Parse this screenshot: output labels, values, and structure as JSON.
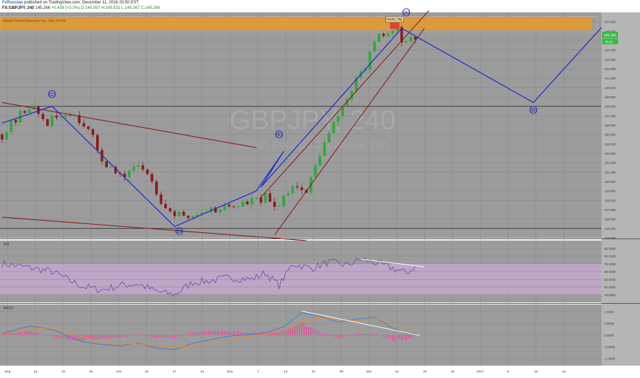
{
  "header": {
    "publisher": "FxRussian",
    "published_text": "published on TradingView.com, December 11, 2016 20:50 EST",
    "symbol": "FX:GBPJPY, 240",
    "last": "145.266",
    "change": "+0.439 (+0.3%)",
    "ohlc": "O:145.097 H:145.531 L:145.087 C:145.266"
  },
  "watermark": {
    "main": "GBPJPY, 240",
    "sub": "British Pound / Japanese Yen"
  },
  "indicator_labels": {
    "series_name": "British Pound/Japanese Yen, 240, FXCM",
    "rsi": "RSI",
    "macd": "MACD"
  },
  "price_tags": {
    "current": "145.266",
    "countdown": "05:02"
  },
  "annotations": {
    "fractal": "FRACTAL",
    "wave_c": "(C)",
    "wave_d": "(D)",
    "wave_e": "(E)",
    "wave_a": "(A)",
    "wave_b": "(B)"
  },
  "colors": {
    "background": "#9c9c9c",
    "grid": "#8a8a8a",
    "up_candle": "#2fa83a",
    "down_candle": "#8a1c1c",
    "channel_line": "#8b1a1a",
    "wave_line": "#1e2fd1",
    "resistance_zone": "#e99a2a",
    "fractal_box": "#e0452b",
    "rsi_line": "#7a4a9e",
    "rsi_band": "#c9aad6",
    "macd_line": "#2f7fd8",
    "signal_line": "#f08a24",
    "histogram": "#e0559a",
    "divergence_line": "#ffffff"
  },
  "chart_data": [
    {
      "panel": "price",
      "type": "candlestick",
      "title": "FX:GBPJPY, 240",
      "ylabel": "",
      "ylim": [
        124.0,
        148.0
      ],
      "y_ticks": [
        "147.000",
        "146.000",
        "145.000",
        "144.000",
        "143.000",
        "142.000",
        "141.000",
        "140.000",
        "139.000",
        "138.000",
        "137.000",
        "136.000",
        "135.000",
        "134.000",
        "133.000",
        "132.000",
        "131.000",
        "130.000",
        "129.000",
        "128.000",
        "127.000",
        "126.000",
        "125.000",
        "124.000"
      ],
      "x_ticks": [
        "Sep",
        "12",
        "19",
        "26",
        "Oct",
        "10",
        "17",
        "24",
        "Nov",
        "7",
        "14",
        "21",
        "28",
        "Dec",
        "12",
        "19",
        "26",
        "2017",
        "9",
        "16",
        "23"
      ],
      "current_price": 145.266,
      "resistance_zone": [
        146.1,
        147.4
      ],
      "horizontal_levels": [
        138.0,
        125.0
      ],
      "price_path": [
        [
          0,
          135.0
        ],
        [
          6,
          138.1
        ],
        [
          10,
          136.2
        ],
        [
          15,
          137.5
        ],
        [
          18,
          136.3
        ],
        [
          22,
          132.5
        ],
        [
          26,
          130.3
        ],
        [
          29,
          131.6
        ],
        [
          32,
          131.0
        ],
        [
          36,
          127.2
        ],
        [
          40,
          126.0
        ],
        [
          44,
          126.9
        ],
        [
          52,
          127.5
        ],
        [
          58,
          128.2
        ],
        [
          60,
          127.1
        ],
        [
          64,
          129.8
        ],
        [
          67,
          128.8
        ],
        [
          70,
          133.0
        ],
        [
          75,
          138.0
        ],
        [
          79,
          141.5
        ],
        [
          83,
          145.3
        ],
        [
          87,
          146.1
        ],
        [
          89,
          144.4
        ],
        [
          91,
          145.3
        ]
      ],
      "wave_points": {
        "start": [
          0,
          137.0
        ],
        "C": [
          11,
          138.0
        ],
        "D": [
          38,
          125.2
        ],
        "E": [
          62,
          134.2
        ],
        "B": [
          117,
          138.1
        ]
      },
      "wave_path": [
        [
          0,
          136.2
        ],
        [
          11,
          138.0
        ],
        [
          38,
          125.2
        ],
        [
          56,
          129.0
        ],
        [
          62,
          133.2
        ],
        [
          57,
          129.4
        ],
        [
          88,
          146.3
        ],
        [
          117,
          138.4
        ],
        [
          132,
          146.4
        ]
      ],
      "channels": [
        {
          "from": [
            0,
            138.4
          ],
          "to": [
            56,
            133.6
          ]
        },
        {
          "from": [
            0,
            126.2
          ],
          "to": [
            67,
            123.7
          ]
        },
        {
          "from": [
            57,
            128.3
          ],
          "to": [
            94,
            148.2
          ]
        },
        {
          "from": [
            60,
            124.3
          ],
          "to": [
            93,
            146.3
          ]
        }
      ]
    },
    {
      "panel": "rsi",
      "type": "line",
      "title": "RSI",
      "ylim": [
        20,
        100
      ],
      "y_ticks": [
        "90.0000",
        "80.0000",
        "70.0000",
        "60.0000",
        "50.0000",
        "40.0000",
        "30.0000"
      ],
      "band": [
        30,
        70
      ],
      "divergence": {
        "from": [
          79,
          76
        ],
        "to": [
          93,
          66
        ]
      },
      "values": [
        [
          0,
          70
        ],
        [
          5,
          66
        ],
        [
          11,
          60
        ],
        [
          15,
          48
        ],
        [
          18,
          40
        ],
        [
          22,
          36
        ],
        [
          26,
          42
        ],
        [
          30,
          44
        ],
        [
          34,
          34
        ],
        [
          38,
          30
        ],
        [
          42,
          46
        ],
        [
          46,
          48
        ],
        [
          50,
          52
        ],
        [
          55,
          50
        ],
        [
          58,
          58
        ],
        [
          61,
          42
        ],
        [
          64,
          70
        ],
        [
          68,
          64
        ],
        [
          72,
          72
        ],
        [
          76,
          68
        ],
        [
          79,
          76
        ],
        [
          83,
          70
        ],
        [
          86,
          64
        ],
        [
          89,
          58
        ],
        [
          91,
          66
        ]
      ]
    },
    {
      "panel": "macd",
      "type": "line",
      "title": "MACD",
      "ylim": [
        -1.3,
        1.3
      ],
      "y_ticks": [
        "1.0000",
        "0.5000",
        "0.0000",
        "-0.5000",
        "-1.0000"
      ],
      "divergence": {
        "from": [
          66,
          1.02
        ],
        "to": [
          92,
          -0.02
        ]
      },
      "series": [
        {
          "name": "MACD",
          "values": [
            [
              0,
              0.05
            ],
            [
              3,
              0.22
            ],
            [
              6,
              0.38
            ],
            [
              9,
              0.3
            ],
            [
              12,
              0.18
            ],
            [
              15,
              -0.1
            ],
            [
              18,
              -0.3
            ],
            [
              22,
              -0.4
            ],
            [
              26,
              -0.45
            ],
            [
              30,
              -0.35
            ],
            [
              34,
              -0.55
            ],
            [
              38,
              -0.62
            ],
            [
              42,
              -0.35
            ],
            [
              46,
              -0.2
            ],
            [
              50,
              -0.05
            ],
            [
              54,
              0.02
            ],
            [
              58,
              0.1
            ],
            [
              62,
              0.35
            ],
            [
              66,
              0.95
            ],
            [
              70,
              0.8
            ],
            [
              74,
              0.55
            ],
            [
              78,
              0.68
            ],
            [
              82,
              0.75
            ],
            [
              86,
              0.3
            ],
            [
              89,
              0.05
            ],
            [
              91,
              0.08
            ]
          ]
        },
        {
          "name": "Signal",
          "values": [
            [
              0,
              0.02
            ],
            [
              3,
              0.12
            ],
            [
              6,
              0.25
            ],
            [
              9,
              0.3
            ],
            [
              12,
              0.25
            ],
            [
              15,
              0.08
            ],
            [
              18,
              -0.12
            ],
            [
              22,
              -0.28
            ],
            [
              26,
              -0.38
            ],
            [
              30,
              -0.38
            ],
            [
              34,
              -0.45
            ],
            [
              38,
              -0.52
            ],
            [
              42,
              -0.45
            ],
            [
              46,
              -0.32
            ],
            [
              50,
              -0.18
            ],
            [
              54,
              -0.06
            ],
            [
              58,
              0.03
            ],
            [
              62,
              0.18
            ],
            [
              66,
              0.55
            ],
            [
              70,
              0.72
            ],
            [
              74,
              0.65
            ],
            [
              78,
              0.62
            ],
            [
              82,
              0.7
            ],
            [
              86,
              0.48
            ],
            [
              89,
              0.22
            ],
            [
              91,
              0.12
            ]
          ]
        }
      ]
    }
  ]
}
